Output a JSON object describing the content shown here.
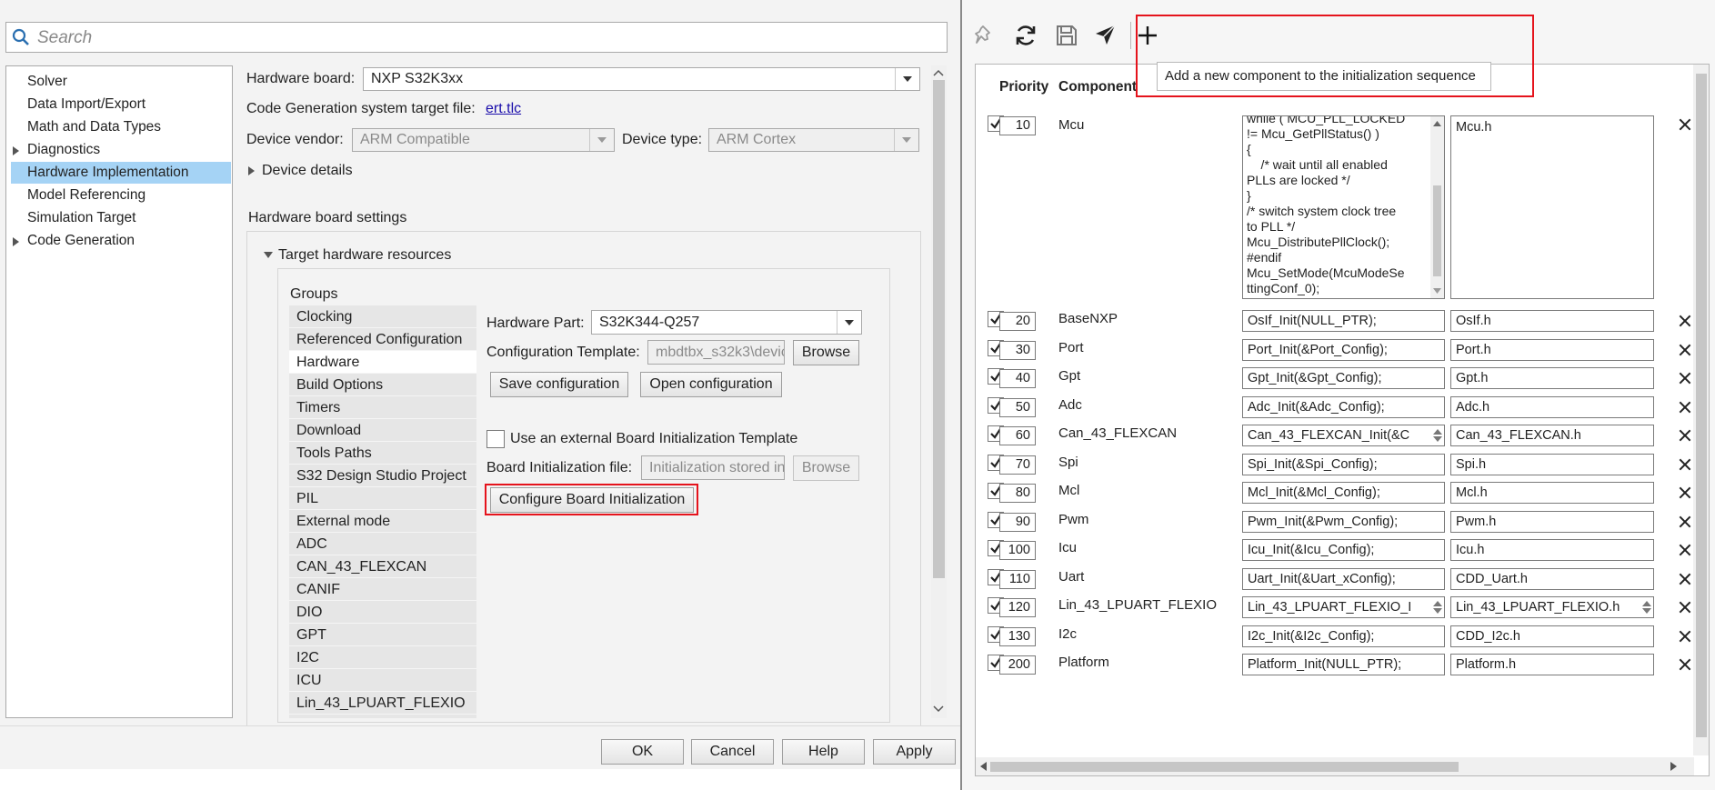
{
  "left_window": {
    "search": {
      "placeholder": "Search"
    },
    "nav": {
      "items": [
        {
          "label": "Solver",
          "expandable": false,
          "selected": false
        },
        {
          "label": "Data Import/Export",
          "expandable": false,
          "selected": false
        },
        {
          "label": "Math and Data Types",
          "expandable": false,
          "selected": false
        },
        {
          "label": "Diagnostics",
          "expandable": true,
          "selected": false
        },
        {
          "label": "Hardware Implementation",
          "expandable": false,
          "selected": true
        },
        {
          "label": "Model Referencing",
          "expandable": false,
          "selected": false
        },
        {
          "label": "Simulation Target",
          "expandable": false,
          "selected": false
        },
        {
          "label": "Code Generation",
          "expandable": true,
          "selected": false
        }
      ]
    },
    "hardware_board": {
      "label": "Hardware board:",
      "value": "NXP S32K3xx"
    },
    "codegen_target": {
      "label": "Code Generation system target file:",
      "value": "ert.tlc"
    },
    "device_vendor": {
      "label": "Device vendor:",
      "value": "ARM Compatible"
    },
    "device_type": {
      "label": "Device type:",
      "value": "ARM Cortex"
    },
    "device_details_label": "Device details",
    "board_settings_title": "Hardware board settings",
    "target_resources_label": "Target hardware resources",
    "groups_label": "Groups",
    "groups": [
      "Clocking",
      "Referenced Configuration",
      "Hardware",
      "Build Options",
      "Timers",
      "Download",
      "Tools Paths",
      "S32 Design Studio Project",
      "PIL",
      "External mode",
      "ADC",
      "CAN_43_FLEXCAN",
      "CANIF",
      "DIO",
      "GPT",
      "I2C",
      "ICU",
      "Lin_43_LPUART_FLEXIO"
    ],
    "selected_group": "Hardware",
    "hardware_part": {
      "label": "Hardware Part:",
      "value": "S32K344-Q257"
    },
    "config_template": {
      "label": "Configuration Template:",
      "value": "mbdtbx_s32k3\\devic",
      "browse_label": "Browse"
    },
    "save_config_label": "Save configuration",
    "open_config_label": "Open configuration",
    "external_template": {
      "label": "Use an external Board Initialization Template",
      "checked": false
    },
    "board_init_file": {
      "label": "Board Initialization file:",
      "value": "Initialization stored in",
      "browse_label": "Browse"
    },
    "configure_init_label": "Configure Board Initialization",
    "buttons": {
      "ok": "OK",
      "cancel": "Cancel",
      "help": "Help",
      "apply": "Apply"
    }
  },
  "right_window": {
    "toolbar": {
      "icons": [
        "pin-icon",
        "refresh-icon",
        "save-icon",
        "send-icon",
        "plus-icon"
      ]
    },
    "tooltip": "Add a new component to the initialization sequence",
    "table": {
      "headers": {
        "priority": "Priority",
        "component": "Component"
      },
      "mcu": {
        "checked": true,
        "priority": "10",
        "component": "Mcu",
        "code_lines": [
          "while ( MCU_PLL_LOCKED",
          "!= Mcu_GetPllStatus() )",
          "{",
          "    /* wait until all enabled",
          "PLLs are locked */",
          "}",
          "/* switch system clock tree",
          "to PLL */",
          "Mcu_DistributePllClock();",
          "#endif",
          "Mcu_SetMode(McuModeSe",
          "ttingConf_0);"
        ],
        "header": "Mcu.h"
      },
      "rows": [
        {
          "checked": true,
          "priority": "20",
          "component": "BaseNXP",
          "init": "OsIf_Init(NULL_PTR);",
          "header": "OsIf.h",
          "init_spin": false,
          "header_spin": false
        },
        {
          "checked": true,
          "priority": "30",
          "component": "Port",
          "init": "Port_Init(&Port_Config);",
          "header": "Port.h",
          "init_spin": false,
          "header_spin": false
        },
        {
          "checked": true,
          "priority": "40",
          "component": "Gpt",
          "init": "Gpt_Init(&Gpt_Config);",
          "header": "Gpt.h",
          "init_spin": false,
          "header_spin": false
        },
        {
          "checked": true,
          "priority": "50",
          "component": "Adc",
          "init": "Adc_Init(&Adc_Config);",
          "header": "Adc.h",
          "init_spin": false,
          "header_spin": false
        },
        {
          "checked": true,
          "priority": "60",
          "component": "Can_43_FLEXCAN",
          "init": "Can_43_FLEXCAN_Init(&C",
          "header": "Can_43_FLEXCAN.h",
          "init_spin": true,
          "header_spin": false
        },
        {
          "checked": true,
          "priority": "70",
          "component": "Spi",
          "init": "Spi_Init(&Spi_Config);",
          "header": "Spi.h",
          "init_spin": false,
          "header_spin": false
        },
        {
          "checked": true,
          "priority": "80",
          "component": "Mcl",
          "init": "Mcl_Init(&Mcl_Config);",
          "header": "Mcl.h",
          "init_spin": false,
          "header_spin": false
        },
        {
          "checked": true,
          "priority": "90",
          "component": "Pwm",
          "init": "Pwm_Init(&Pwm_Config);",
          "header": "Pwm.h",
          "init_spin": false,
          "header_spin": false
        },
        {
          "checked": true,
          "priority": "100",
          "component": "Icu",
          "init": "Icu_Init(&Icu_Config);",
          "header": "Icu.h",
          "init_spin": false,
          "header_spin": false
        },
        {
          "checked": true,
          "priority": "110",
          "component": "Uart",
          "init": "Uart_Init(&Uart_xConfig);",
          "header": "CDD_Uart.h",
          "init_spin": false,
          "header_spin": false
        },
        {
          "checked": true,
          "priority": "120",
          "component": "Lin_43_LPUART_FLEXIO",
          "init": "Lin_43_LPUART_FLEXIO_I",
          "header": "Lin_43_LPUART_FLEXIO.h",
          "init_spin": true,
          "header_spin": true
        },
        {
          "checked": true,
          "priority": "130",
          "component": "I2c",
          "init": "I2c_Init(&I2c_Config);",
          "header": "CDD_I2c.h",
          "init_spin": false,
          "header_spin": false
        },
        {
          "checked": true,
          "priority": "200",
          "component": "Platform",
          "init": "Platform_Init(NULL_PTR);",
          "header": "Platform.h",
          "init_spin": false,
          "header_spin": false
        }
      ]
    }
  },
  "colors": {
    "highlight": "#e5131c",
    "selection": "#a5d3f5"
  }
}
